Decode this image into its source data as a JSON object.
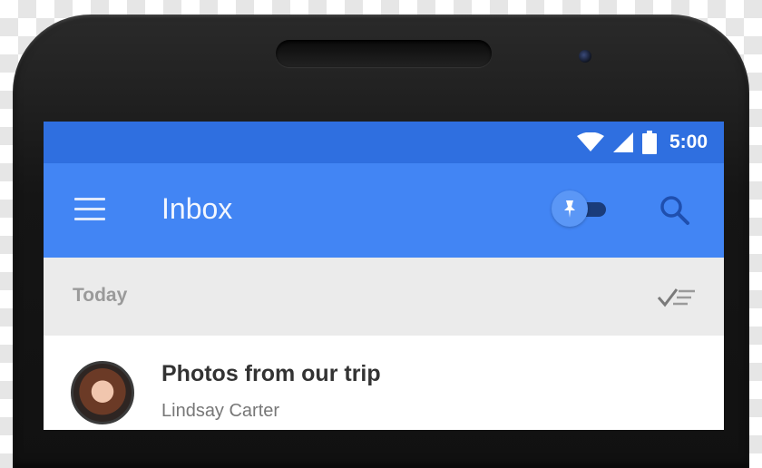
{
  "status_bar": {
    "time": "5:00",
    "icons": [
      "wifi-icon",
      "signal-icon",
      "battery-icon"
    ]
  },
  "app_bar": {
    "title": "Inbox",
    "icons": [
      "menu-icon",
      "pin-toggle-icon",
      "search-icon"
    ]
  },
  "section": {
    "title": "Today",
    "action_icon": "done-all-icon"
  },
  "mail": {
    "subject": "Photos from our trip",
    "sender": "Lindsay Carter"
  },
  "colors": {
    "status_bar": "#2f6fe0",
    "app_bar": "#4285f4",
    "section_bg": "#ebebeb"
  }
}
